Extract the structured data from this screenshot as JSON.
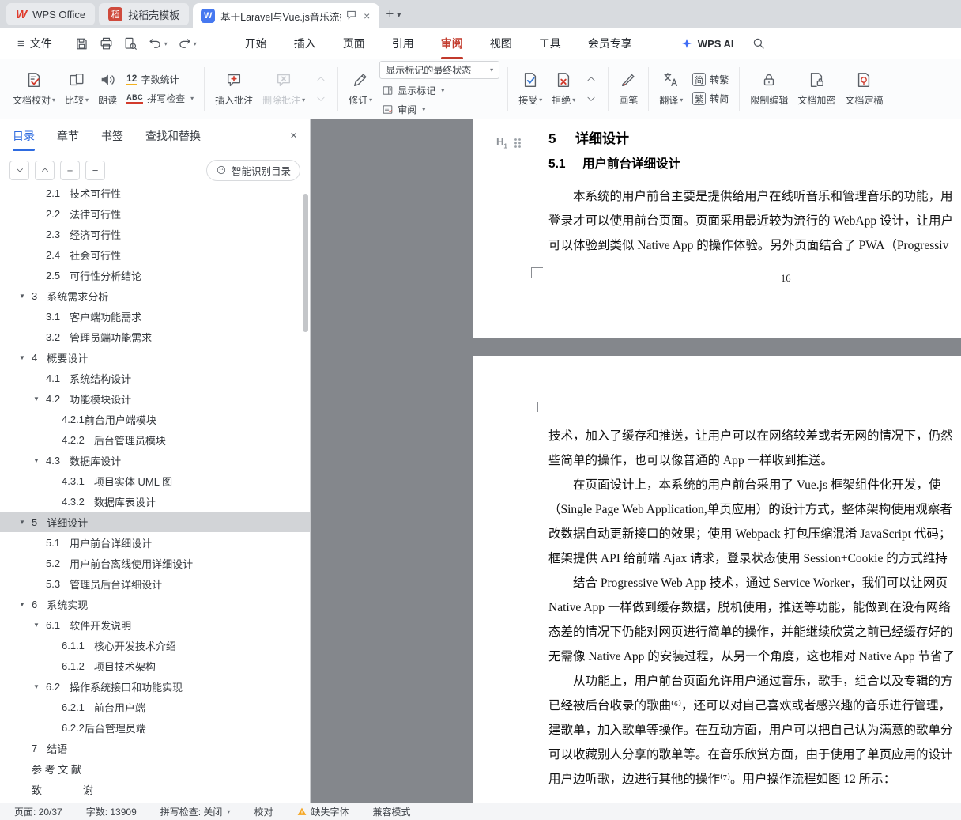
{
  "tabs": {
    "app": "WPS Office",
    "template": "找稻壳模板",
    "doc": "基于Laravel与Vue.js音乐流媒"
  },
  "menu": {
    "file": "文件",
    "items": [
      "开始",
      "插入",
      "页面",
      "引用",
      "审阅",
      "视图",
      "工具",
      "会员专享"
    ],
    "active_item": "审阅",
    "wps_ai": "WPS AI"
  },
  "ribbon": {
    "doc_proof": "文档校对",
    "compare": "比较",
    "read_aloud": "朗读",
    "word_count": "字数统计",
    "count_icon": "12",
    "spell_check": "拼写检查",
    "abc_icon": "ABC",
    "insert_comment": "插入批注",
    "delete_comment": "删除批注",
    "track_changes": "修订",
    "markup_state": "显示标记的最终状态",
    "show_markup": "显示标记",
    "review": "审阅",
    "accept": "接受",
    "reject": "拒绝",
    "pen": "画笔",
    "translate": "翻译",
    "jian": "简",
    "to_trad": "转繁",
    "fan": "繁",
    "to_simp": "转简",
    "restrict": "限制编辑",
    "encrypt": "文档加密",
    "finalize": "文档定稿"
  },
  "sidebar": {
    "tabs": [
      "目录",
      "章节",
      "书签",
      "查找和替换"
    ],
    "active_tab": "目录",
    "smart_toc": "智能识别目录",
    "toc": [
      {
        "num": "2.1",
        "title": "技术可行性",
        "level": 1,
        "clipped": true
      },
      {
        "num": "2.2",
        "title": "法律可行性",
        "level": 1
      },
      {
        "num": "2.3",
        "title": "经济可行性",
        "level": 1
      },
      {
        "num": "2.4",
        "title": "社会可行性",
        "level": 1
      },
      {
        "num": "2.5",
        "title": "可行性分析结论",
        "level": 1
      },
      {
        "num": "3",
        "title": "系统需求分析",
        "level": 0,
        "caret": true
      },
      {
        "num": "3.1",
        "title": "客户端功能需求",
        "level": 1
      },
      {
        "num": "3.2",
        "title": "管理员端功能需求",
        "level": 1
      },
      {
        "num": "4",
        "title": "概要设计",
        "level": 0,
        "caret": true
      },
      {
        "num": "4.1",
        "title": "系统结构设计",
        "level": 1
      },
      {
        "num": "4.2",
        "title": "功能模块设计",
        "level": 1,
        "caret": true
      },
      {
        "num": "4.2.1",
        "title": "前台用户端模块",
        "level": 2,
        "tight": true
      },
      {
        "num": "4.2.2",
        "title": "后台管理员模块",
        "level": 2
      },
      {
        "num": "4.3",
        "title": "数据库设计",
        "level": 1,
        "caret": true
      },
      {
        "num": "4.3.1",
        "title": "项目实体 UML 图",
        "level": 2
      },
      {
        "num": "4.3.2",
        "title": "数据库表设计",
        "level": 2
      },
      {
        "num": "5",
        "title": "详细设计",
        "level": 0,
        "caret": true,
        "selected": true
      },
      {
        "num": "5.1",
        "title": "用户前台详细设计",
        "level": 1
      },
      {
        "num": "5.2",
        "title": "用户前台离线使用详细设计",
        "level": 1
      },
      {
        "num": "5.3",
        "title": "管理员后台详细设计",
        "level": 1
      },
      {
        "num": "6",
        "title": "系统实现",
        "level": 0,
        "caret": true
      },
      {
        "num": "6.1",
        "title": "软件开发说明",
        "level": 1,
        "caret": true
      },
      {
        "num": "6.1.1",
        "title": "核心开发技术介绍",
        "level": 2
      },
      {
        "num": "6.1.2",
        "title": "项目技术架构",
        "level": 2
      },
      {
        "num": "6.2",
        "title": "操作系统接口和功能实现",
        "level": 1,
        "caret": true
      },
      {
        "num": "6.2.1",
        "title": "前台用户端",
        "level": 2
      },
      {
        "num": "6.2.2",
        "title": "后台管理员端",
        "level": 2,
        "tight": true
      },
      {
        "num": "7",
        "title": "结语",
        "level": 0
      },
      {
        "num": "",
        "title": "参 考 文 献",
        "level": 0
      },
      {
        "num": "",
        "title": "致　　　　谢",
        "level": 0
      }
    ]
  },
  "document": {
    "page1": {
      "heading_num": "5",
      "heading_title": "详细设计",
      "sub_num": "5.1",
      "sub_title": "用户前台详细设计",
      "lines": [
        {
          "t": "本系统的用户前台主要是提供给用户在线听音乐和管理音乐的功能，用",
          "indent": true
        },
        {
          "t": "登录才可以使用前台页面。页面采用最近较为流行的 WebApp 设计，让用户"
        },
        {
          "t": "可以体验到类似 Native App 的操作体验。另外页面结合了 PWA（Progressiv"
        }
      ],
      "page_number": "16"
    },
    "page2": {
      "lines": [
        {
          "t": "技术，加入了缓存和推送，让用户可以在网络较差或者无网的情况下，仍然"
        },
        {
          "t": "些简单的操作，也可以像普通的 App 一样收到推送。"
        },
        {
          "t": "在页面设计上，本系统的用户前台采用了 Vue.js 框架组件化开发，使",
          "indent": true
        },
        {
          "t": "（Single Page Web Application,单页应用）的设计方式，整体架构使用观察者"
        },
        {
          "t": "改数据自动更新接口的效果；使用 Webpack 打包压缩混淆 JavaScript 代码；"
        },
        {
          "t": "框架提供 API 给前端 Ajax 请求，登录状态使用 Session+Cookie 的方式维持"
        },
        {
          "t": "结合 Progressive Web App 技术，通过 Service Worker，我们可以让网页",
          "indent": true
        },
        {
          "t": "Native App 一样做到缓存数据，脱机使用，推送等功能，能做到在没有网络"
        },
        {
          "t": "态差的情况下仍能对网页进行简单的操作，并能继续欣赏之前已经缓存好的"
        },
        {
          "t": "无需像 Native App 的安装过程，从另一个角度，这也相对 Native App 节省了"
        },
        {
          "t": "从功能上，用户前台页面允许用户通过音乐，歌手，组合以及专辑的方",
          "indent": true
        },
        {
          "t": "已经被后台收录的歌曲⁽⁶⁾，还可以对自己喜欢或者感兴趣的音乐进行管理，"
        },
        {
          "t": "建歌单，加入歌单等操作。在互动方面，用户可以把自己认为满意的歌单分"
        },
        {
          "t": "可以收藏别人分享的歌单等。在音乐欣赏方面，由于使用了单页应用的设计"
        },
        {
          "t": "用户边听歌，边进行其他的操作⁽⁷⁾。用户操作流程如图 12 所示："
        }
      ]
    }
  },
  "status": {
    "page_label": "页面: 20/37",
    "words_label": "字数: 13909",
    "spell_label": "拼写检查: 关闭",
    "proof_label": "校对",
    "missing_font_label": "缺失字体",
    "compat_label": "兼容模式"
  },
  "icons": {
    "hamburger": "≡",
    "dropdown": "▾",
    "close": "×",
    "plus": "+",
    "minus": "−",
    "toc_expanded": "▼",
    "w_logo": "W",
    "docer_glyph": "稻",
    "heading_letter": "H"
  },
  "colors": {
    "accent_red": "#c23a2c",
    "accent_blue": "#2e6be0",
    "writer_blue": "#4678f0",
    "docer_red": "#cf4a3c",
    "warning_yellow": "#f5a623",
    "doc_background": "#84878c"
  }
}
